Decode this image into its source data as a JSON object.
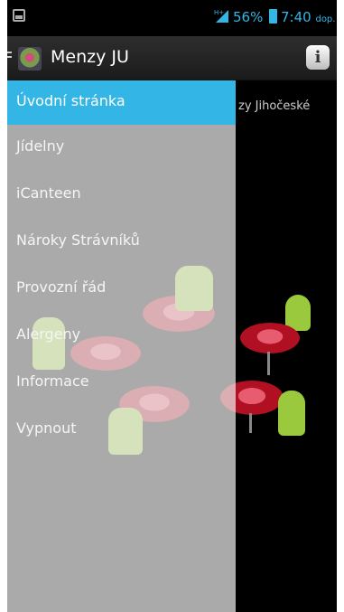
{
  "status_bar": {
    "battery_percent": "56%",
    "time": "7:40",
    "time_suffix": "dop.",
    "accent_color": "#33b5e5"
  },
  "action_bar": {
    "title": "Menzy JU",
    "info_icon_glyph": "i",
    "app_icon": "menzy-logo-icon"
  },
  "content": {
    "intro_text_fragment": "zy Jihočeské"
  },
  "drawer": {
    "items": [
      {
        "label": "Úvodní stránka",
        "active": true
      },
      {
        "label": "Jídelny"
      },
      {
        "label": "iCanteen"
      },
      {
        "label": "Nároky Strávníků"
      },
      {
        "label": "Provozní řád"
      },
      {
        "label": "Alergeny"
      },
      {
        "label": "Informace"
      },
      {
        "label": "Vypnout"
      }
    ]
  },
  "colors": {
    "active_item": "#33b5e5",
    "background": "#000000"
  }
}
